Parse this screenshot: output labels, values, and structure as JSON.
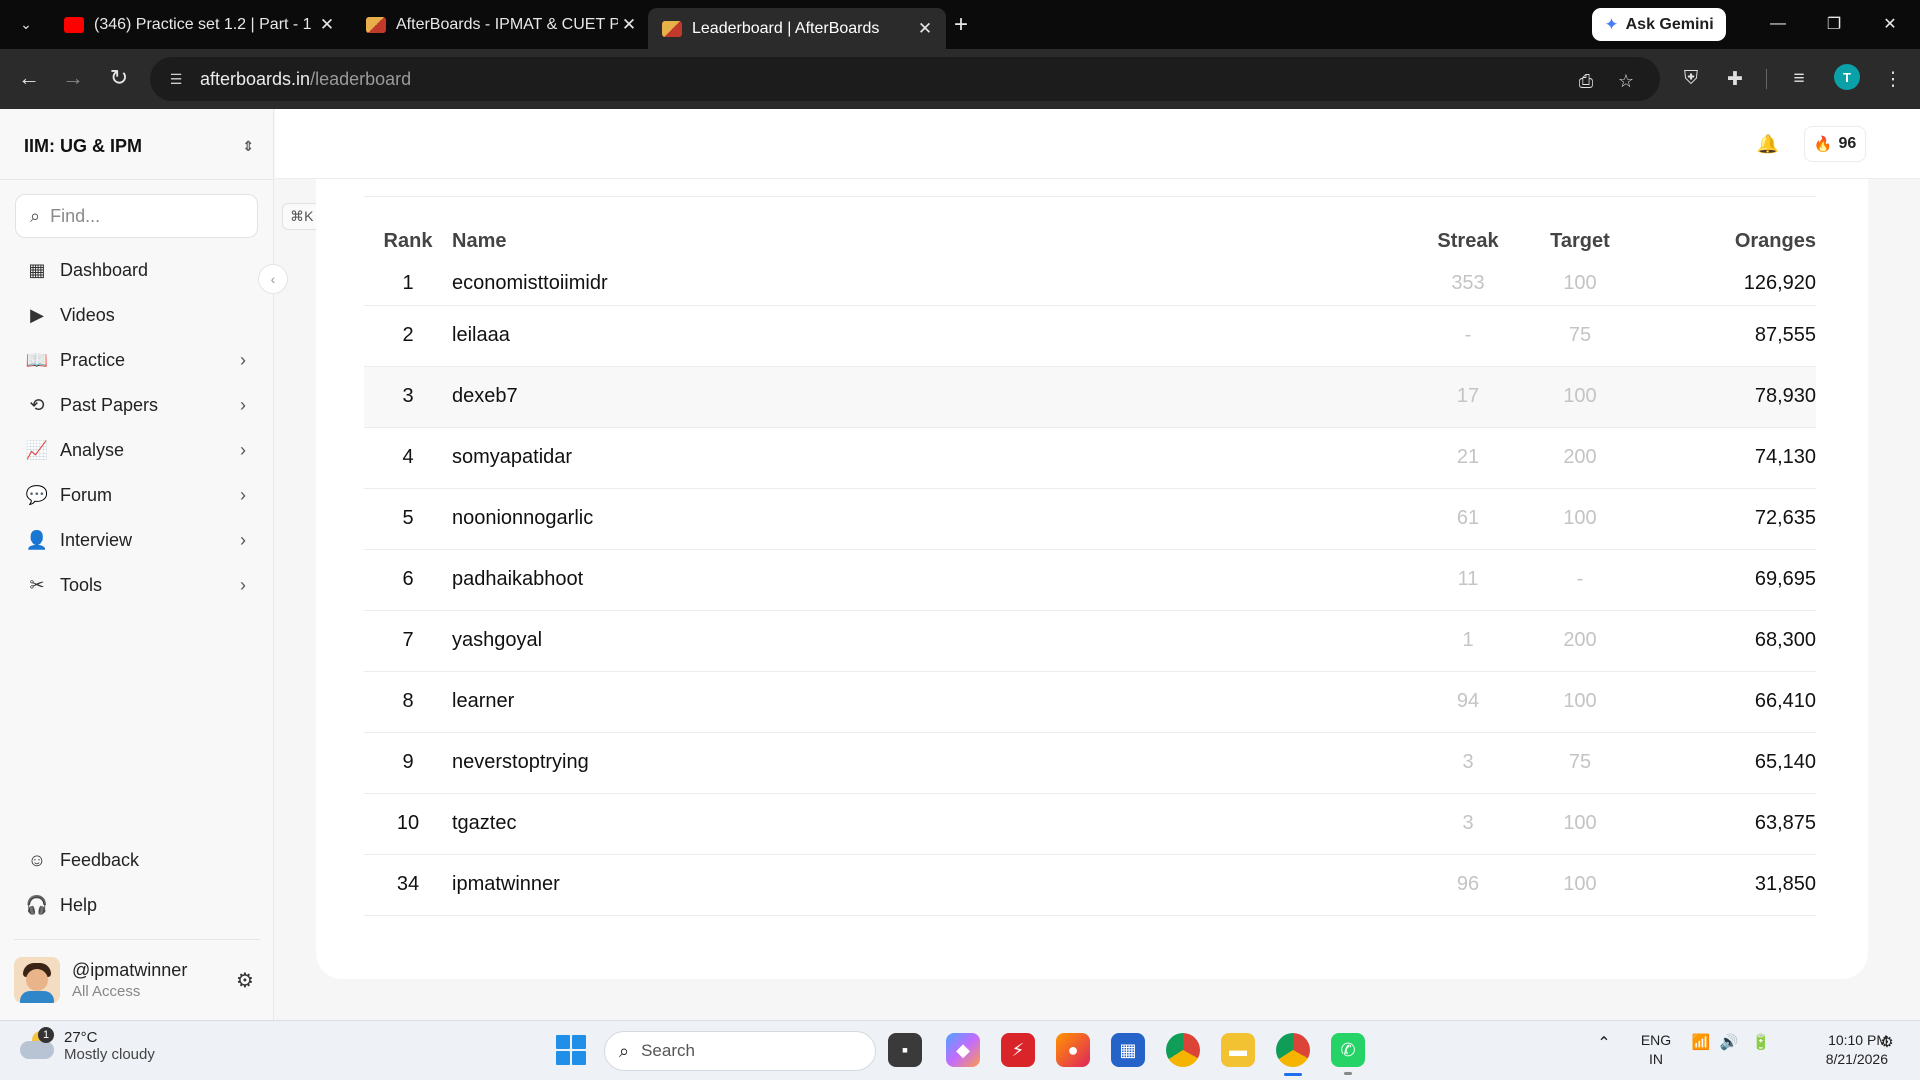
{
  "browser": {
    "tabs": [
      {
        "title": "(346) Practice set 1.2 | Part - 1 |",
        "favicon_color": "#ff0000",
        "active": false
      },
      {
        "title": "AfterBoards - IPMAT & CUET Pr",
        "favicon_color": "#e8b04a",
        "active": false
      },
      {
        "title": "Leaderboard | AfterBoards",
        "favicon_color": "#e8b04a",
        "active": true
      }
    ],
    "new_tab_icon": "plus-icon",
    "ask_gemini_label": "Ask Gemini",
    "url_host": "afterboards.in",
    "url_path": "/leaderboard",
    "profile_initial": "T",
    "profile_color": "#0aa2a8"
  },
  "sidebar": {
    "workspace": "IIM: UG & IPM",
    "search_placeholder": "Find...",
    "search_shortcut": "⌘K",
    "items": [
      {
        "label": "Dashboard",
        "icon": "dashboard-icon",
        "glyph": "▦",
        "has_submenu": false
      },
      {
        "label": "Videos",
        "icon": "video-icon",
        "glyph": "▶",
        "has_submenu": false
      },
      {
        "label": "Practice",
        "icon": "book-icon",
        "glyph": "📖",
        "has_submenu": true
      },
      {
        "label": "Past Papers",
        "icon": "history-icon",
        "glyph": "⟲",
        "has_submenu": true
      },
      {
        "label": "Analyse",
        "icon": "chart-icon",
        "glyph": "📈",
        "has_submenu": true
      },
      {
        "label": "Forum",
        "icon": "chat-icon",
        "glyph": "💬",
        "has_submenu": true
      },
      {
        "label": "Interview",
        "icon": "person-icon",
        "glyph": "👤",
        "has_submenu": true
      },
      {
        "label": "Tools",
        "icon": "tools-icon",
        "glyph": "✂",
        "has_submenu": true
      }
    ],
    "footer_items": [
      {
        "label": "Feedback",
        "icon": "smile-icon",
        "glyph": "☺"
      },
      {
        "label": "Help",
        "icon": "headset-icon",
        "glyph": "🎧"
      }
    ],
    "user": {
      "handle": "@ipmatwinner",
      "plan": "All Access"
    }
  },
  "header": {
    "streak_count": "96",
    "accent_color": "#f28b1e"
  },
  "leaderboard": {
    "columns": {
      "rank": "Rank",
      "name": "Name",
      "streak": "Streak",
      "target": "Target",
      "oranges": "Oranges"
    },
    "rows": [
      {
        "rank": "1",
        "name": "economisttoiimidr",
        "streak": "353",
        "target": "100",
        "oranges": "126,920"
      },
      {
        "rank": "2",
        "name": "leilaaa",
        "streak": "-",
        "target": "75",
        "oranges": "87,555"
      },
      {
        "rank": "3",
        "name": "dexeb7",
        "streak": "17",
        "target": "100",
        "oranges": "78,930"
      },
      {
        "rank": "4",
        "name": "somyapatidar",
        "streak": "21",
        "target": "200",
        "oranges": "74,130"
      },
      {
        "rank": "5",
        "name": "noonionnogarlic",
        "streak": "61",
        "target": "100",
        "oranges": "72,635"
      },
      {
        "rank": "6",
        "name": "padhaikabhoot",
        "streak": "11",
        "target": "-",
        "oranges": "69,695"
      },
      {
        "rank": "7",
        "name": "yashgoyal",
        "streak": "1",
        "target": "200",
        "oranges": "68,300"
      },
      {
        "rank": "8",
        "name": "learner",
        "streak": "94",
        "target": "100",
        "oranges": "66,410"
      },
      {
        "rank": "9",
        "name": "neverstoptrying",
        "streak": "3",
        "target": "75",
        "oranges": "65,140"
      },
      {
        "rank": "10",
        "name": "tgaztec",
        "streak": "3",
        "target": "100",
        "oranges": "63,875"
      },
      {
        "rank": "34",
        "name": "ipmatwinner",
        "streak": "96",
        "target": "100",
        "oranges": "31,850"
      }
    ]
  },
  "taskbar": {
    "weather_temp": "27°C",
    "weather_condition": "Mostly cloudy",
    "weather_badge": "1",
    "search_label": "Search",
    "lang_line1": "ENG",
    "lang_line2": "IN",
    "time": "10:10 PM",
    "date": "8/21/2026"
  }
}
